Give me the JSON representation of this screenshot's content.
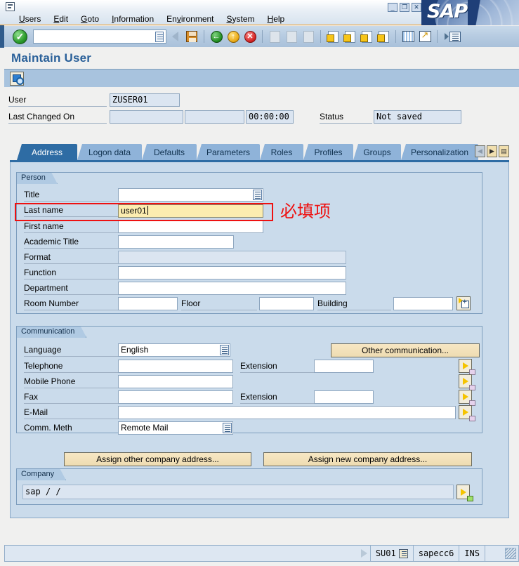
{
  "window": {
    "app_name": "SAP",
    "minimize_glyph": "_",
    "maximize_glyph": "❐",
    "close_glyph": "✕"
  },
  "menu": {
    "items": [
      {
        "label": "Users"
      },
      {
        "label": "Edit"
      },
      {
        "label": "Goto"
      },
      {
        "label": "Information"
      },
      {
        "label": "Environment"
      },
      {
        "label": "System"
      },
      {
        "label": "Help"
      }
    ]
  },
  "toolbar": {
    "enter_glyph": "✓",
    "command_field_value": "",
    "command_field_placeholder": "",
    "buttons": [
      {
        "name": "back-button"
      },
      {
        "name": "save-button"
      },
      {
        "name": "back-green-button"
      },
      {
        "name": "exit-yellow-button"
      },
      {
        "name": "cancel-red-button"
      },
      {
        "name": "print-button"
      },
      {
        "name": "find-button"
      },
      {
        "name": "find-next-button"
      },
      {
        "name": "first-page-button"
      },
      {
        "name": "previous-page-button"
      },
      {
        "name": "next-page-button"
      },
      {
        "name": "last-page-button"
      },
      {
        "name": "new-session-button"
      },
      {
        "name": "create-shortcut-button"
      },
      {
        "name": "help-button"
      },
      {
        "name": "customize-layout-button"
      }
    ]
  },
  "page": {
    "title": "Maintain User",
    "app_toolbar": {
      "measurements_icon": "magnifier-icon"
    }
  },
  "header": {
    "user_label": "User",
    "user_value": "ZUSER01",
    "last_changed_label": "Last Changed On",
    "last_changed_date": "",
    "last_changed_by": "",
    "last_changed_time": "00:00:00",
    "status_label": "Status",
    "status_value": "Not saved"
  },
  "tabs": {
    "items": [
      {
        "label": "Address",
        "active": true
      },
      {
        "label": "Logon data",
        "active": false
      },
      {
        "label": "Defaults",
        "active": false
      },
      {
        "label": "Parameters",
        "active": false
      },
      {
        "label": "Roles",
        "active": false
      },
      {
        "label": "Profiles",
        "active": false
      },
      {
        "label": "Groups",
        "active": false
      },
      {
        "label": "Personalization",
        "active": false
      }
    ],
    "nav": {
      "prev_glyph": "◀",
      "next_glyph": "▶",
      "list_glyph": "▤"
    }
  },
  "person": {
    "group_title": "Person",
    "fields": {
      "title_label": "Title",
      "title_value": "",
      "last_name_label": "Last name",
      "last_name_value": "user01",
      "first_name_label": "First name",
      "first_name_value": "",
      "academic_title_label": "Academic Title",
      "academic_title_value": "",
      "format_label": "Format",
      "format_value": "",
      "function_label": "Function",
      "function_value": "",
      "department_label": "Department",
      "department_value": "",
      "room_number_label": "Room Number",
      "room_number_value": "",
      "floor_label": "Floor",
      "floor_value": "",
      "building_label": "Building",
      "building_value": ""
    }
  },
  "annotation": {
    "text": "必填项",
    "color": "#ee1111",
    "target_field": "last-name-input"
  },
  "communication": {
    "group_title": "Communication",
    "fields": {
      "language_label": "Language",
      "language_value": "English",
      "telephone_label": "Telephone",
      "telephone_value": "",
      "telephone_ext_label": "Extension",
      "telephone_ext_value": "",
      "mobile_label": "Mobile Phone",
      "mobile_value": "",
      "fax_label": "Fax",
      "fax_value": "",
      "fax_ext_label": "Extension",
      "fax_ext_value": "",
      "email_label": "E-Mail",
      "email_value": "",
      "comm_method_label": "Comm. Meth",
      "comm_method_value": "Remote Mail"
    },
    "other_communication_button": "Other communication..."
  },
  "company": {
    "assign_other_button": "Assign other company address...",
    "assign_new_button": "Assign new company address...",
    "group_title": "Company",
    "value": "sap / /"
  },
  "statusbar": {
    "message": "",
    "transaction": "SU01",
    "system": "sapecc6",
    "insert_mode": "INS"
  },
  "colors": {
    "accent_blue": "#2e6ca4",
    "title_blue": "#2a6099",
    "panel_blue": "#cadbeb",
    "button_tan": "#eedcb2",
    "required_red": "#ee1111",
    "focus_yellow": "#fcedb0"
  }
}
